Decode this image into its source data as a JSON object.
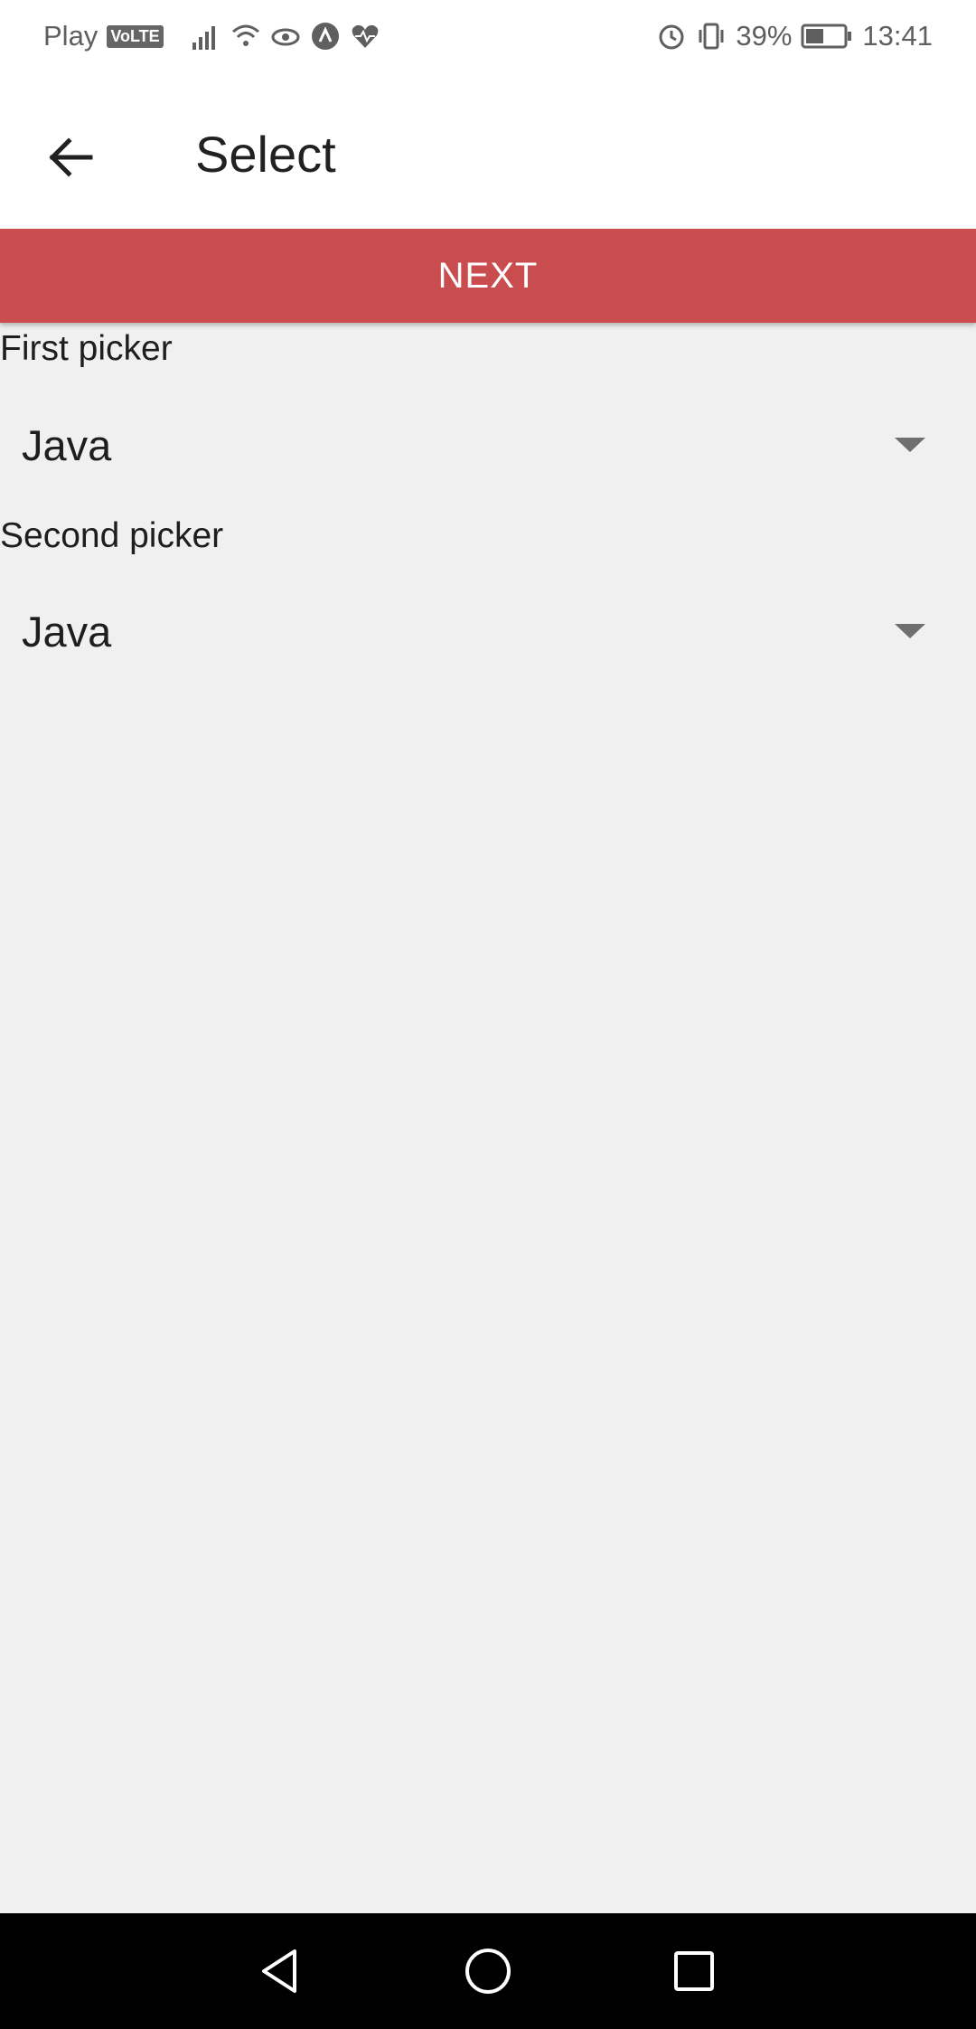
{
  "status_bar": {
    "carrier": "Play",
    "volte": "VoLTE",
    "battery": "39%",
    "time": "13:41"
  },
  "app_bar": {
    "title": "Select"
  },
  "next_button": {
    "label": "NEXT"
  },
  "pickers": [
    {
      "label": "First picker",
      "value": "Java"
    },
    {
      "label": "Second picker",
      "value": "Java"
    }
  ],
  "colors": {
    "accent": "#c94d4f",
    "background": "#f0f0f0"
  },
  "icons": {
    "back": "arrow-left-icon",
    "dropdown": "caret-down-icon",
    "nav_back": "triangle-back-icon",
    "nav_home": "circle-home-icon",
    "nav_recents": "square-recents-icon"
  }
}
